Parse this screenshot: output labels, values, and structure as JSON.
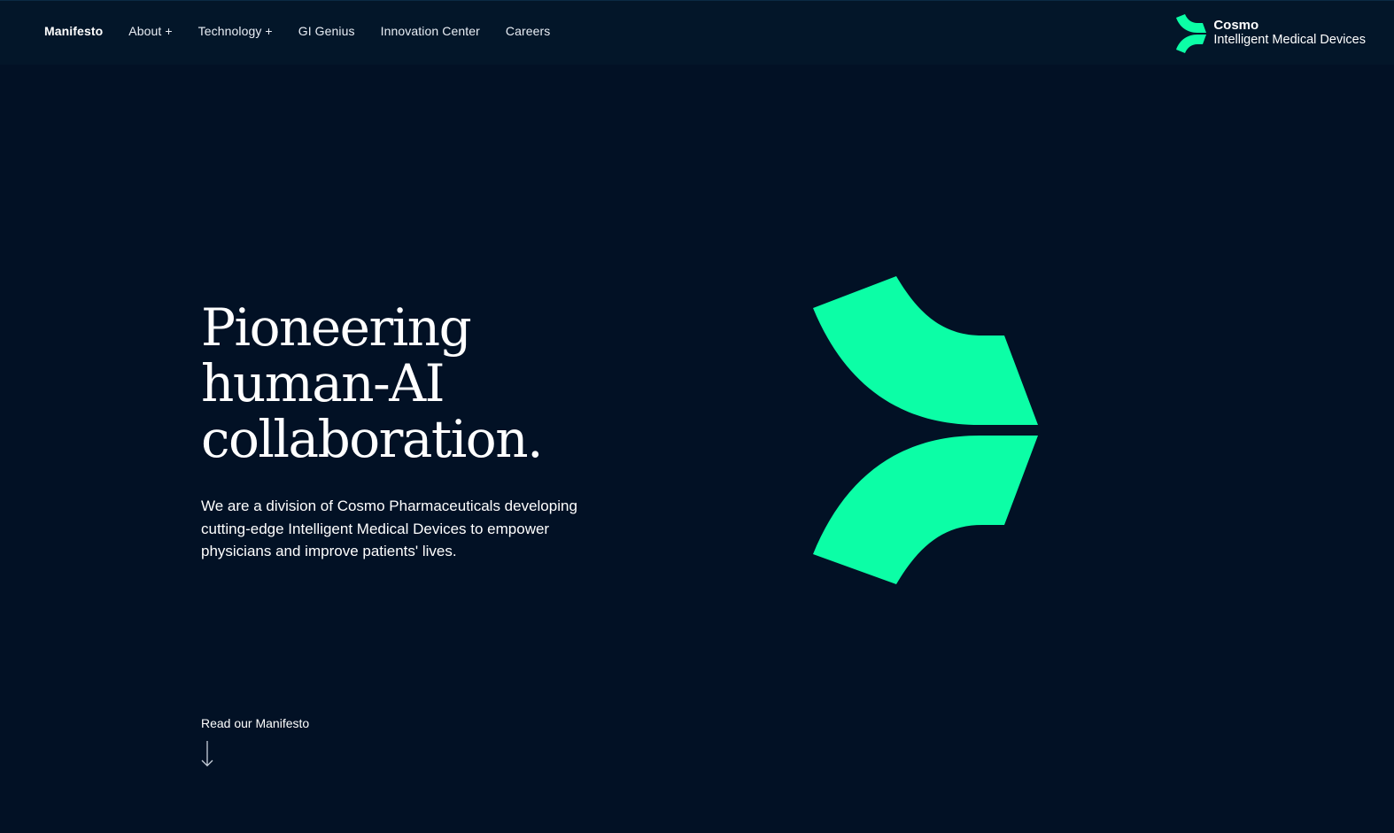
{
  "nav": {
    "items": [
      {
        "label": "Manifesto",
        "active": true
      },
      {
        "label": "About +"
      },
      {
        "label": "Technology +"
      },
      {
        "label": "GI Genius"
      },
      {
        "label": "Innovation Center"
      },
      {
        "label": "Careers"
      }
    ]
  },
  "brand": {
    "name": "Cosmo",
    "subtitle": "Intelligent Medical Devices",
    "icon": "cosmo-logo-mark"
  },
  "hero": {
    "title_lines": [
      "Pioneering",
      "human-AI",
      "collaboration."
    ],
    "description": "We are a division of Cosmo Pharmaceuticals developing cutting-edge Intelligent Medical Devices to empower physicians and improve patients' lives.",
    "cta_label": "Read our Manifesto",
    "cta_icon": "arrow-down-icon"
  },
  "colors": {
    "background": "#021125",
    "header": "#031629",
    "accent": "#0cfea6",
    "text": "#ffffff"
  }
}
